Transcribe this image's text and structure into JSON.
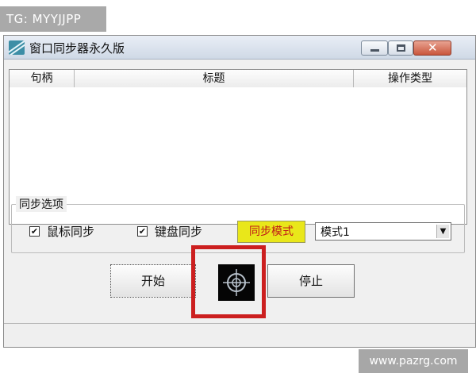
{
  "watermarks": {
    "top_left": "TG: MYYJJPP",
    "bottom_right": "www.pazrg.com"
  },
  "window": {
    "title": "窗口同步器永久版",
    "icon": "app-icon",
    "controls": [
      "minimize-icon",
      "maximize-icon",
      "close-icon"
    ]
  },
  "list": {
    "columns": [
      "句柄",
      "标题",
      "操作类型"
    ],
    "rows": []
  },
  "sync_options": {
    "group_label": "同步选项",
    "mouse_sync": {
      "label": "鼠标同步",
      "checked": true
    },
    "keyboard_sync": {
      "label": "键盘同步",
      "checked": true
    },
    "mode_button": "同步模式",
    "mode_select": {
      "value": "模式1"
    }
  },
  "actions": {
    "start": "开始",
    "stop": "停止"
  },
  "colors": {
    "mode_button_bg": "#e9e71a",
    "mode_button_text": "#c01818",
    "highlight_box": "#cc1f1f"
  }
}
